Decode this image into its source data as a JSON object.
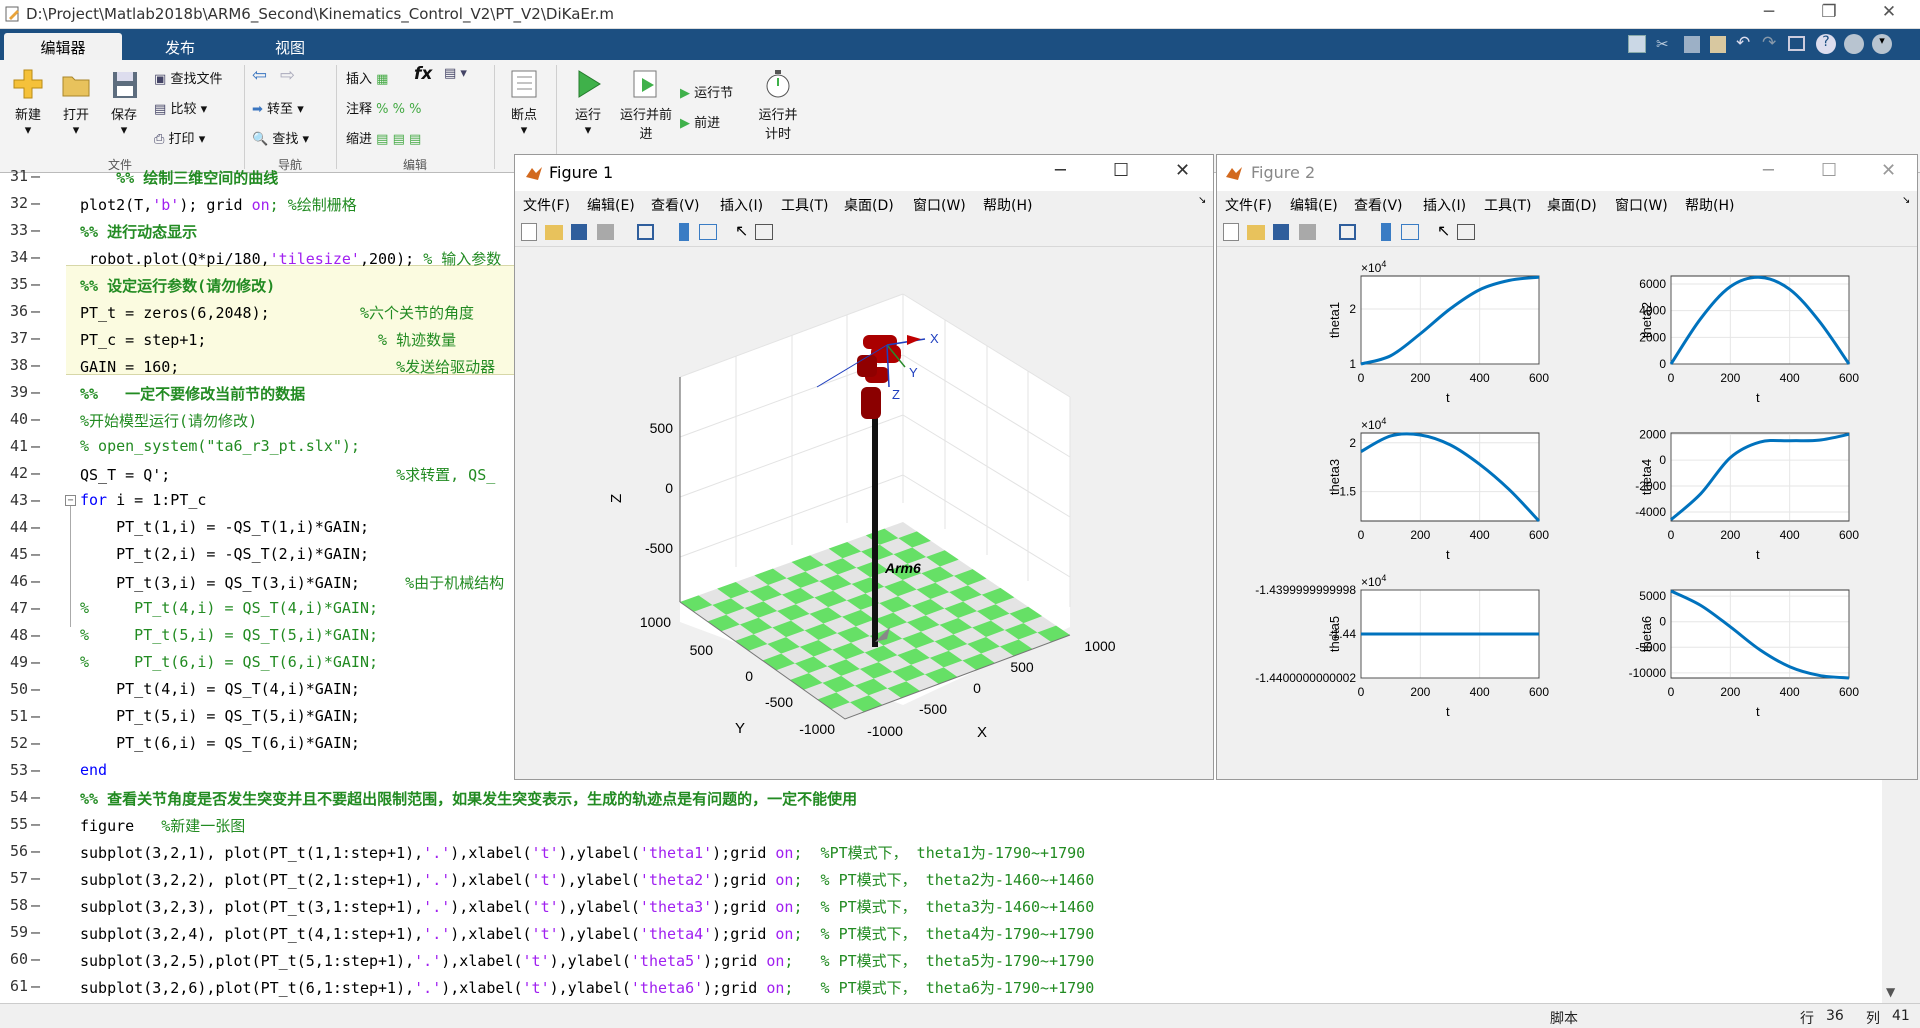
{
  "window": {
    "title": "D:\\Project\\Matlab2018b\\ARM6_Second\\Kinematics_Control_V2\\PT_V2\\DiKaEr.m"
  },
  "tabs": [
    "编辑器",
    "发布",
    "视图"
  ],
  "toolstrip": {
    "new": "新建",
    "open": "打开",
    "save": "保存",
    "find_files": "查找文件",
    "compare": "比较",
    "print": "打印",
    "goto": "转至",
    "find": "查找",
    "insert": "插入",
    "comment": "注释",
    "indent": "缩进",
    "fx": "fx",
    "breakpoints": "断点",
    "run": "运行",
    "run_advance": "运行并前进",
    "run_section": "运行节",
    "advance": "前进",
    "run_time": "运行并计时",
    "groups": {
      "file": "文件",
      "navigate": "导航",
      "edit": "编辑",
      "breakpoints": "断点",
      "run": "运行"
    }
  },
  "editor": {
    "lines": [
      {
        "n": "31",
        "segs": [
          {
            "t": "    %% 绘制三维空间的曲线",
            "c": "cmb"
          }
        ]
      },
      {
        "n": "32",
        "segs": [
          {
            "t": "plot2(T,",
            "c": ""
          },
          {
            "t": "'b'",
            "c": "st"
          },
          {
            "t": "); grid ",
            "c": ""
          },
          {
            "t": "on",
            "c": "st"
          },
          {
            "t": "; %绘制栅格",
            "c": "cm"
          }
        ]
      },
      {
        "n": "33",
        "segs": [
          {
            "t": "%% 进行动态显示",
            "c": "cmb"
          }
        ]
      },
      {
        "n": "34",
        "segs": [
          {
            "t": " robot.plot(Q*pi/180,",
            "c": ""
          },
          {
            "t": "'tilesize'",
            "c": "st"
          },
          {
            "t": ",200); ",
            "c": ""
          },
          {
            "t": "% 输入参数",
            "c": "cm"
          }
        ]
      },
      {
        "n": "35",
        "segs": [
          {
            "t": "%% 设定运行参数(请勿修改)",
            "c": "cmb"
          }
        ]
      },
      {
        "n": "36",
        "segs": [
          {
            "t": "PT_t = zeros(6,2048);          ",
            "c": ""
          },
          {
            "t": "%六个关节的角度",
            "c": "cm"
          }
        ]
      },
      {
        "n": "37",
        "segs": [
          {
            "t": "PT_c = step+1;                   ",
            "c": ""
          },
          {
            "t": "% 轨迹数量",
            "c": "cm"
          }
        ]
      },
      {
        "n": "38",
        "segs": [
          {
            "t": "GAIN = 160;                        ",
            "c": ""
          },
          {
            "t": "%发送给驱动器",
            "c": "cm"
          }
        ]
      },
      {
        "n": "39",
        "segs": [
          {
            "t": "%%   一定不要修改当前节的数据",
            "c": "cmb"
          }
        ]
      },
      {
        "n": "40",
        "segs": [
          {
            "t": "%开始模型运行(请勿修改)",
            "c": "cm"
          }
        ]
      },
      {
        "n": "41",
        "segs": [
          {
            "t": "% open_system(\"ta6_r3_pt.slx\");",
            "c": "cm"
          }
        ]
      },
      {
        "n": "42",
        "segs": [
          {
            "t": "QS_T = Q';                         ",
            "c": ""
          },
          {
            "t": "%求转置, QS_",
            "c": "cm"
          }
        ]
      },
      {
        "n": "43",
        "segs": [
          {
            "t": "for",
            "c": "kw"
          },
          {
            "t": " i = 1:PT_c",
            "c": ""
          }
        ]
      },
      {
        "n": "44",
        "segs": [
          {
            "t": "    PT_t(1,i) = -QS_T(1,i)*GAIN;",
            "c": ""
          }
        ]
      },
      {
        "n": "45",
        "segs": [
          {
            "t": "    PT_t(2,i) = -QS_T(2,i)*GAIN;",
            "c": ""
          }
        ]
      },
      {
        "n": "46",
        "segs": [
          {
            "t": "    PT_t(3,i) = QS_T(3,i)*GAIN;     ",
            "c": ""
          },
          {
            "t": "%由于机械结构",
            "c": "cm"
          }
        ]
      },
      {
        "n": "47",
        "segs": [
          {
            "t": "%     PT_t(4,i) = QS_T(4,i)*GAIN;",
            "c": "cm"
          }
        ]
      },
      {
        "n": "48",
        "segs": [
          {
            "t": "%     PT_t(5,i) = QS_T(5,i)*GAIN;",
            "c": "cm"
          }
        ]
      },
      {
        "n": "49",
        "segs": [
          {
            "t": "%     PT_t(6,i) = QS_T(6,i)*GAIN;",
            "c": "cm"
          }
        ]
      },
      {
        "n": "50",
        "segs": [
          {
            "t": "    PT_t(4,i) = QS_T(4,i)*GAIN;",
            "c": ""
          }
        ]
      },
      {
        "n": "51",
        "segs": [
          {
            "t": "    PT_t(5,i) = QS_T(5,i)*GAIN;",
            "c": ""
          }
        ]
      },
      {
        "n": "52",
        "segs": [
          {
            "t": "    PT_t(6,i) = QS_T(6,i)*GAIN;",
            "c": ""
          }
        ]
      },
      {
        "n": "53",
        "segs": [
          {
            "t": "end",
            "c": "kw"
          }
        ]
      },
      {
        "n": "54",
        "segs": [
          {
            "t": "%% 查看关节角度是否发生突变并且不要超出限制范围，如果发生突变表示，生成的轨迹点是有问题的，一定不能使用",
            "c": "cmb"
          }
        ]
      },
      {
        "n": "55",
        "segs": [
          {
            "t": "figure   ",
            "c": ""
          },
          {
            "t": "%新建一张图",
            "c": "cm"
          }
        ]
      },
      {
        "n": "56",
        "segs": [
          {
            "t": "subplot(3,2,1), plot(PT_t(1,1:step+1),",
            "c": ""
          },
          {
            "t": "'.'",
            "c": "st"
          },
          {
            "t": "),xlabel(",
            "c": ""
          },
          {
            "t": "'t'",
            "c": "st"
          },
          {
            "t": "),ylabel(",
            "c": ""
          },
          {
            "t": "'theta1'",
            "c": "st"
          },
          {
            "t": ");grid ",
            "c": ""
          },
          {
            "t": "on",
            "c": "st"
          },
          {
            "t": ";  %PT模式下， theta1为-1790~+1790",
            "c": "cm"
          }
        ]
      },
      {
        "n": "57",
        "segs": [
          {
            "t": "subplot(3,2,2), plot(PT_t(2,1:step+1),",
            "c": ""
          },
          {
            "t": "'.'",
            "c": "st"
          },
          {
            "t": "),xlabel(",
            "c": ""
          },
          {
            "t": "'t'",
            "c": "st"
          },
          {
            "t": "),ylabel(",
            "c": ""
          },
          {
            "t": "'theta2'",
            "c": "st"
          },
          {
            "t": ");grid ",
            "c": ""
          },
          {
            "t": "on",
            "c": "st"
          },
          {
            "t": ";  % PT模式下， theta2为-1460~+1460",
            "c": "cm"
          }
        ]
      },
      {
        "n": "58",
        "segs": [
          {
            "t": "subplot(3,2,3), plot(PT_t(3,1:step+1),",
            "c": ""
          },
          {
            "t": "'.'",
            "c": "st"
          },
          {
            "t": "),xlabel(",
            "c": ""
          },
          {
            "t": "'t'",
            "c": "st"
          },
          {
            "t": "),ylabel(",
            "c": ""
          },
          {
            "t": "'theta3'",
            "c": "st"
          },
          {
            "t": ");grid ",
            "c": ""
          },
          {
            "t": "on",
            "c": "st"
          },
          {
            "t": ";  % PT模式下， theta3为-1460~+1460",
            "c": "cm"
          }
        ]
      },
      {
        "n": "59",
        "segs": [
          {
            "t": "subplot(3,2,4), plot(PT_t(4,1:step+1),",
            "c": ""
          },
          {
            "t": "'.'",
            "c": "st"
          },
          {
            "t": "),xlabel(",
            "c": ""
          },
          {
            "t": "'t'",
            "c": "st"
          },
          {
            "t": "),ylabel(",
            "c": ""
          },
          {
            "t": "'theta4'",
            "c": "st"
          },
          {
            "t": ");grid ",
            "c": ""
          },
          {
            "t": "on",
            "c": "st"
          },
          {
            "t": ";  % PT模式下， theta4为-1790~+1790",
            "c": "cm"
          }
        ]
      },
      {
        "n": "60",
        "segs": [
          {
            "t": "subplot(3,2,5),plot(PT_t(5,1:step+1),",
            "c": ""
          },
          {
            "t": "'.'",
            "c": "st"
          },
          {
            "t": "),xlabel(",
            "c": ""
          },
          {
            "t": "'t'",
            "c": "st"
          },
          {
            "t": "),ylabel(",
            "c": ""
          },
          {
            "t": "'theta5'",
            "c": "st"
          },
          {
            "t": ");grid ",
            "c": ""
          },
          {
            "t": "on",
            "c": "st"
          },
          {
            "t": ";   % PT模式下， theta5为-1790~+1790",
            "c": "cm"
          }
        ]
      },
      {
        "n": "61",
        "segs": [
          {
            "t": "subplot(3,2,6),plot(PT_t(6,1:step+1),",
            "c": ""
          },
          {
            "t": "'.'",
            "c": "st"
          },
          {
            "t": "),xlabel(",
            "c": ""
          },
          {
            "t": "'t'",
            "c": "st"
          },
          {
            "t": "),ylabel(",
            "c": ""
          },
          {
            "t": "'theta6'",
            "c": "st"
          },
          {
            "t": ");grid ",
            "c": ""
          },
          {
            "t": "on",
            "c": "st"
          },
          {
            "t": ";   % PT模式下， theta6为-1790~+1790",
            "c": "cm"
          }
        ]
      }
    ]
  },
  "figure1": {
    "title": "Figure 1",
    "menus": [
      "文件(F)",
      "编辑(E)",
      "查看(V)",
      "插入(I)",
      "工具(T)",
      "桌面(D)",
      "窗口(W)",
      "帮助(H)"
    ],
    "robot_label": "Arm6",
    "z_label": "Z",
    "y_label": "Y",
    "x_label": "X",
    "z_ticks": [
      "500",
      "0",
      "-500"
    ],
    "y_ticks": [
      "1000",
      "500",
      "0",
      "-500",
      "-1000"
    ],
    "x_ticks": [
      "-1000",
      "-500",
      "0",
      "500",
      "1000"
    ],
    "frame_labels": [
      "X",
      "Y",
      "Z"
    ]
  },
  "figure2": {
    "title": "Figure 2",
    "menus": [
      "文件(F)",
      "编辑(E)",
      "查看(V)",
      "插入(I)",
      "工具(T)",
      "桌面(D)",
      "窗口(W)",
      "帮助(H)"
    ]
  },
  "chart_data": [
    {
      "type": "line",
      "ylabel": "theta1",
      "xlabel": "t",
      "xlim": [
        0,
        600
      ],
      "ylim": [
        1,
        2.6
      ],
      "exponent": "×10^4",
      "x": [
        0,
        100,
        200,
        300,
        400,
        500,
        600
      ],
      "values": [
        1.0,
        1.15,
        1.55,
        2.0,
        2.35,
        2.52,
        2.58
      ],
      "xticks": [
        "0",
        "200",
        "400",
        "600"
      ],
      "yticks": [
        "1",
        "2"
      ]
    },
    {
      "type": "line",
      "ylabel": "theta2",
      "xlabel": "t",
      "xlim": [
        0,
        600
      ],
      "ylim": [
        0,
        6600
      ],
      "x": [
        0,
        100,
        200,
        300,
        400,
        500,
        600
      ],
      "values": [
        0,
        3400,
        5800,
        6500,
        5600,
        3200,
        0
      ],
      "xticks": [
        "0",
        "200",
        "400",
        "600"
      ],
      "yticks": [
        "0",
        "2000",
        "4000",
        "6000"
      ]
    },
    {
      "type": "line",
      "ylabel": "theta3",
      "xlabel": "t",
      "xlim": [
        0,
        600
      ],
      "ylim": [
        1.2,
        2.1
      ],
      "exponent": "×10^4",
      "x": [
        0,
        100,
        200,
        300,
        400,
        500,
        600
      ],
      "values": [
        1.91,
        2.07,
        2.08,
        1.98,
        1.78,
        1.52,
        1.2
      ],
      "xticks": [
        "0",
        "200",
        "400",
        "600"
      ],
      "yticks": [
        "1.5",
        "2"
      ]
    },
    {
      "type": "line",
      "ylabel": "theta4",
      "xlabel": "t",
      "xlim": [
        0,
        600
      ],
      "ylim": [
        -4700,
        2100
      ],
      "x": [
        0,
        100,
        200,
        300,
        400,
        500,
        600
      ],
      "values": [
        -4600,
        -2600,
        200,
        1400,
        1500,
        1550,
        2000
      ],
      "xticks": [
        "0",
        "200",
        "400",
        "600"
      ],
      "yticks": [
        "-4000",
        "-2000",
        "0",
        "2000"
      ]
    },
    {
      "type": "line",
      "ylabel": "theta5",
      "xlabel": "t",
      "xlim": [
        0,
        600
      ],
      "ylim": [
        -1.4400000000002,
        -1.4399999999998
      ],
      "exponent": "×10^4",
      "x": [
        0,
        600
      ],
      "values": [
        -1.44,
        -1.44
      ],
      "xticks": [
        "0",
        "200",
        "400",
        "600"
      ],
      "yticks": [
        "-1.4399999999998",
        "-1.44",
        "-1.4400000000002"
      ]
    },
    {
      "type": "line",
      "ylabel": "theta6",
      "xlabel": "t",
      "xlim": [
        0,
        600
      ],
      "ylim": [
        -11000,
        6200
      ],
      "x": [
        0,
        100,
        200,
        300,
        400,
        500,
        600
      ],
      "values": [
        6000,
        3200,
        -1000,
        -5500,
        -8800,
        -10500,
        -11000
      ],
      "xticks": [
        "0",
        "200",
        "400",
        "600"
      ],
      "yticks": [
        "5000",
        "0",
        "-5000",
        "-10000"
      ]
    }
  ],
  "status": {
    "mode": "脚本",
    "row_label": "行",
    "row": "36",
    "col_label": "列",
    "col": "41"
  }
}
